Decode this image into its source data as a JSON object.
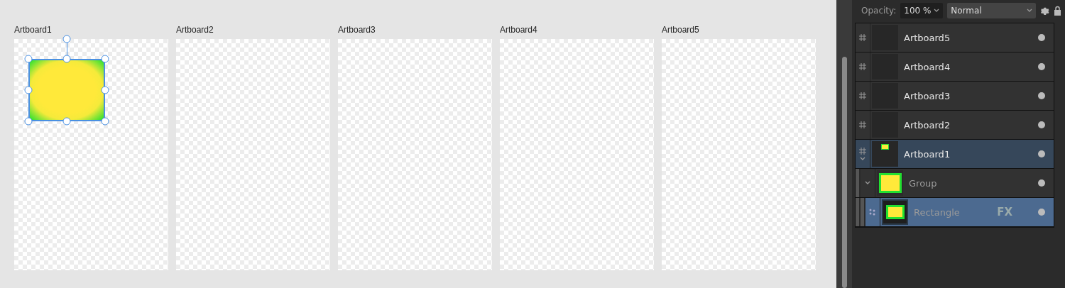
{
  "canvas": {
    "artboards": [
      {
        "label": "Artboard1",
        "shapes": [
          {
            "kind": "rectangle",
            "selected": true
          }
        ]
      },
      {
        "label": "Artboard2"
      },
      {
        "label": "Artboard3"
      },
      {
        "label": "Artboard4"
      },
      {
        "label": "Artboard5"
      }
    ]
  },
  "layers_panel": {
    "opacity_label": "Opacity:",
    "opacity_value": "100 %",
    "blend_mode": "Normal",
    "layers": [
      {
        "kind": "artboard",
        "name": "Artboard5",
        "selected": false,
        "contains_selection": false
      },
      {
        "kind": "artboard",
        "name": "Artboard4",
        "selected": false,
        "contains_selection": false
      },
      {
        "kind": "artboard",
        "name": "Artboard3",
        "selected": false,
        "contains_selection": false
      },
      {
        "kind": "artboard",
        "name": "Artboard2",
        "selected": false,
        "contains_selection": false
      },
      {
        "kind": "artboard",
        "name": "Artboard1",
        "selected": false,
        "contains_selection": true,
        "expanded": true,
        "children": [
          {
            "kind": "group",
            "name": "Group",
            "selected": false,
            "expanded": true,
            "children": [
              {
                "kind": "shape",
                "name": "Rectangle",
                "selected": true,
                "fx_label": "FX"
              }
            ]
          }
        ]
      }
    ]
  }
}
